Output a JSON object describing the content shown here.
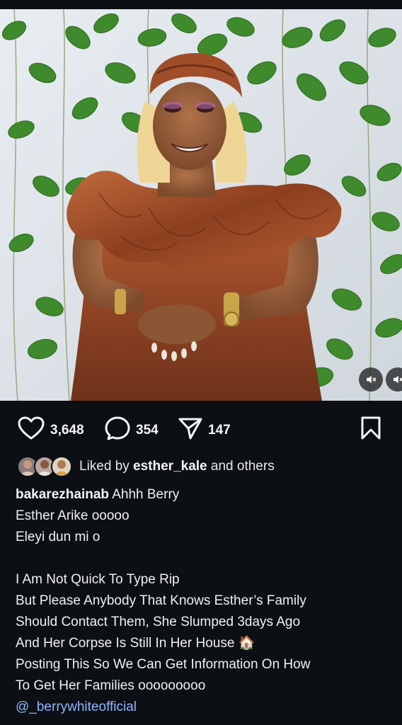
{
  "post": {
    "actions": {
      "likes": "3,648",
      "comments": "354",
      "shares": "147"
    },
    "liked_by": {
      "prefix": "Liked by ",
      "user": "esther_kale",
      "suffix": " and others"
    },
    "caption": {
      "username": "bakarezhainab",
      "first_line_text": " Ahhh Berry",
      "lines": [
        "Esther Arike ooooo",
        "Eleyi dun mi o",
        "",
        "I Am Not Quick To Type Rip",
        "But Please Anybody That Knows Esther’s Family",
        "Should Contact Them, She Slumped 3days Ago",
        "And Her Corpse Is Still In Her House 🏠",
        "Posting This So We Can Get Information On How",
        "To Get Her Families ooooooooo"
      ],
      "mention": "@_berrywhiteofficial"
    },
    "media": {
      "mute_icon": "speaker-muted-icon"
    }
  },
  "theme": {
    "background": "#0c1014",
    "text": "#f5f5f5",
    "link": "#8fb4ff"
  }
}
